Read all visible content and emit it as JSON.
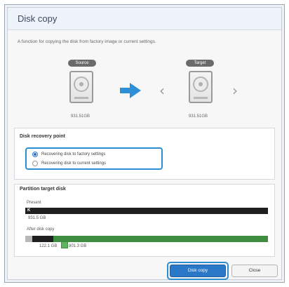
{
  "window": {
    "title": "Disk copy"
  },
  "description": "A function for copying the disk from factory image or current settings.",
  "source": {
    "badge": "Source",
    "size": "931.51GB"
  },
  "target": {
    "badge": "Target",
    "size": "931.51GB"
  },
  "recovery": {
    "title": "Disk recovery point",
    "options": [
      {
        "label": "Recovering disk to factory settings",
        "selected": true
      },
      {
        "label": "Recovering disk to current settings",
        "selected": false
      }
    ]
  },
  "partition": {
    "title": "Partition target disk",
    "present_label": "Present",
    "present_drive": "K",
    "present_size": "931.5 GB",
    "after_label": "After disk copy",
    "after_c": "C",
    "after_d": "D",
    "after_c_size": "122.1 GB",
    "after_d_size": "801.3 GB"
  },
  "buttons": {
    "copy": "Disk copy",
    "close": "Close"
  },
  "colors": {
    "accent": "#2a8fd2",
    "primary": "#2b78c9",
    "green": "#3f8e3f",
    "dark": "#1f1f1f"
  },
  "icons": {
    "arrow": "arrow-right-icon",
    "prev": "chevron-left-icon",
    "next": "chevron-right-icon",
    "disk": "hard-disk-icon"
  }
}
